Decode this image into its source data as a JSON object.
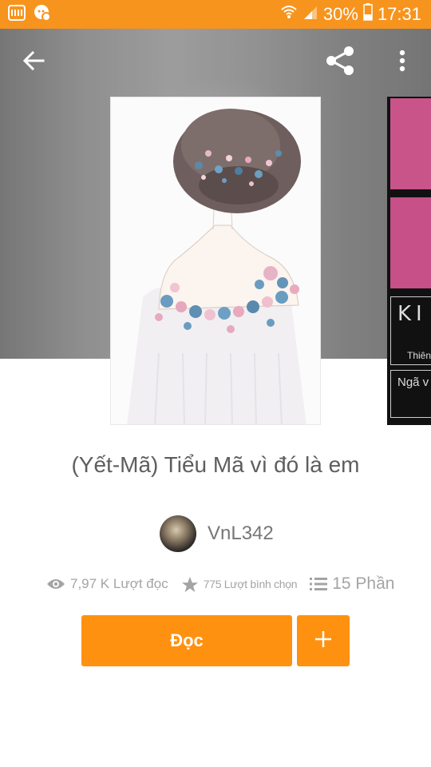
{
  "status_bar": {
    "battery_percent": "30%",
    "time": "17:31",
    "icons": [
      "app-notification-icon",
      "chat-notification-icon",
      "wifi-icon",
      "signal-icon",
      "battery-icon"
    ]
  },
  "nav": {
    "icons": [
      "back-arrow-icon",
      "share-icon",
      "more-vertical-icon"
    ]
  },
  "story": {
    "title": "(Yết-Mã) Tiểu Mã vì đó là em",
    "author": "VnL342",
    "stats": {
      "reads": "7,97 K Lượt đọc",
      "votes": "775 Lượt bình chọn",
      "parts": "15 Phần"
    }
  },
  "next_cover": {
    "text_1": "KI",
    "text_2": "Thiên",
    "text_3": "Ngã v"
  },
  "actions": {
    "read_label": "Đọc",
    "add_label": "+"
  },
  "colors": {
    "accent": "#ff9111",
    "status_bar": "#f7941d",
    "text_muted": "#a4a4a4"
  }
}
